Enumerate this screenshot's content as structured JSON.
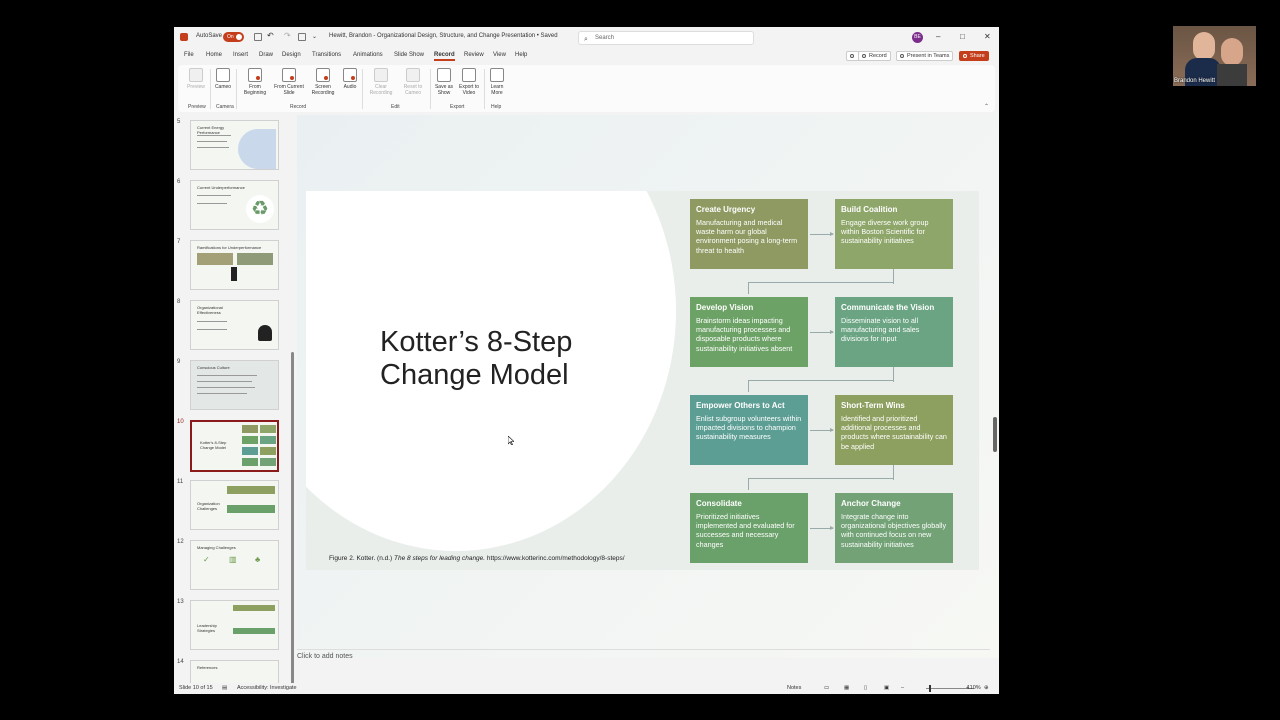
{
  "window": {
    "autosave_label": "AutoSave",
    "autosave_state": "On",
    "doc_title": "Hewitt, Brandon - Organizational Design, Structure, and Change Presentation • Saved",
    "search_placeholder": "Search",
    "avatar_initials": "BE",
    "minimize": "–",
    "maximize": "□",
    "close": "✕"
  },
  "menu": {
    "tabs": [
      "File",
      "Home",
      "Insert",
      "Draw",
      "Design",
      "Transitions",
      "Animations",
      "Slide Show",
      "Record",
      "Review",
      "View",
      "Help"
    ],
    "active_tab": "Record",
    "record_btn": "Record",
    "teams_btn": "Present in Teams",
    "share_btn": "Share"
  },
  "ribbon": {
    "buttons": [
      {
        "label": "Preview",
        "enabled": false
      },
      {
        "label": "Cameo",
        "enabled": true
      },
      {
        "label": "From Beginning",
        "enabled": true
      },
      {
        "label": "From Current Slide",
        "enabled": true
      },
      {
        "label": "Screen Recording",
        "enabled": true
      },
      {
        "label": "Audio",
        "enabled": true
      },
      {
        "label": "Clear Recording",
        "enabled": false
      },
      {
        "label": "Reset to Cameo",
        "enabled": false
      },
      {
        "label": "Save as Show",
        "enabled": true
      },
      {
        "label": "Export to Video",
        "enabled": true
      },
      {
        "label": "Learn More",
        "enabled": true
      }
    ],
    "groups": [
      "Preview",
      "Camera",
      "Record",
      "Edit",
      "Export",
      "Help"
    ]
  },
  "thumbnails": [
    {
      "num": "5",
      "title": "Current Energy Performance"
    },
    {
      "num": "6",
      "title": "Current Underperformance"
    },
    {
      "num": "7",
      "title": "Ramifications for Underperformance"
    },
    {
      "num": "8",
      "title": "Organizational Effectiveness"
    },
    {
      "num": "9",
      "title": "Conscious Culture"
    },
    {
      "num": "10",
      "title": "Kotter's 8-Step Change Model",
      "selected": true
    },
    {
      "num": "11",
      "title": "Organization Challenges"
    },
    {
      "num": "12",
      "title": "Managing Challenges"
    },
    {
      "num": "13",
      "title": "Leadership Strategies"
    },
    {
      "num": "14",
      "title": "References"
    }
  ],
  "slide": {
    "title_line1": "Kotter’s 8-Step",
    "title_line2": "Change Model",
    "steps": [
      {
        "title": "Create Urgency",
        "body": "Manufacturing and medical waste harm our global environment posing a long-term threat to health",
        "color": "#8e9a62"
      },
      {
        "title": "Build Coalition",
        "body": "Engage diverse work group within Boston Scientific for sustainability initiatives",
        "color": "#8fa66a"
      },
      {
        "title": "Develop Vision",
        "body": "Brainstorm ideas impacting manufacturing processes and disposable products where sustainability initiatives absent",
        "color": "#6da266"
      },
      {
        "title": "Communicate the Vision",
        "body": "Disseminate vision to all manufacturing and sales divisions for input",
        "color": "#6aa483"
      },
      {
        "title": "Empower Others to Act",
        "body": "Enlist subgroup volunteers within impacted divisions to champion sustainability measures",
        "color": "#5d9e94"
      },
      {
        "title": "Short-Term Wins",
        "body": "Identified and prioritized additional processes and products where sustainability can be applied",
        "color": "#8ea060"
      },
      {
        "title": "Consolidate",
        "body": "Prioritized initiatives implemented and evaluated for successes and necessary changes",
        "color": "#6aa06a"
      },
      {
        "title": "Anchor Change",
        "body": "Integrate change into organizational objectives globally with continued focus on new sustainability initiatives",
        "color": "#72a276"
      }
    ],
    "caption_prefix": "Figure 2. Kotter. (n.d.) ",
    "caption_italic": "The 8 steps for leading change.",
    "caption_suffix": " https://www.kotterinc.com/methodology/8-steps/"
  },
  "notes_placeholder": "Click to add notes",
  "status": {
    "slide_count": "Slide 10 of 15",
    "accessibility": "Accessibility: Investigate",
    "notes": "Notes",
    "zoom": "110%"
  },
  "webcam": {
    "name": "Brandon Hewitt"
  }
}
